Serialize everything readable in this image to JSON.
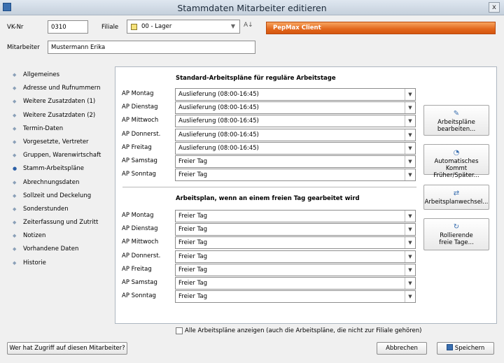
{
  "window": {
    "title": "Stammdaten Mitarbeiter editieren",
    "close": "x"
  },
  "header": {
    "vknr_label": "VK-Nr",
    "vknr_value": "0310",
    "filiale_label": "Filiale",
    "filiale_value": "00 - Lager",
    "mitarbeiter_label": "Mitarbeiter",
    "mitarbeiter_value": "Mustermann Erika",
    "banner_text": "PepMax Client",
    "banner_color": "#e2661b"
  },
  "sidebar": {
    "items": [
      {
        "label": "Allgemeines"
      },
      {
        "label": "Adresse und Rufnummern"
      },
      {
        "label": "Weitere Zusatzdaten (1)"
      },
      {
        "label": "Weitere Zusatzdaten (2)"
      },
      {
        "label": "Termin-Daten"
      },
      {
        "label": "Vorgesetzte, Vertreter"
      },
      {
        "label": "Gruppen, Warenwirtschaft"
      },
      {
        "label": "Stamm-Arbeitspläne",
        "active": true
      },
      {
        "label": "Abrechnungsdaten"
      },
      {
        "label": "Sollzeit und Deckelung"
      },
      {
        "label": "Sonderstunden"
      },
      {
        "label": "Zeiterfassung und Zutritt"
      },
      {
        "label": "Notizen"
      },
      {
        "label": "Vorhandene Daten"
      },
      {
        "label": "Historie"
      }
    ]
  },
  "standard": {
    "title": "Standard-Arbeitspläne für reguläre Arbeitstage",
    "rows": [
      {
        "day": "AP Montag",
        "value": "Auslieferung (08:00-16:45)"
      },
      {
        "day": "AP Dienstag",
        "value": "Auslieferung (08:00-16:45)"
      },
      {
        "day": "AP Mittwoch",
        "value": "Auslieferung (08:00-16:45)"
      },
      {
        "day": "AP Donnerst.",
        "value": "Auslieferung (08:00-16:45)"
      },
      {
        "day": "AP Freitag",
        "value": "Auslieferung (08:00-16:45)"
      },
      {
        "day": "AP Samstag",
        "value": "Freier Tag"
      },
      {
        "day": "AP Sonntag",
        "value": "Freier Tag"
      }
    ]
  },
  "free": {
    "title": "Arbeitsplan, wenn an einem freien Tag gearbeitet wird",
    "rows": [
      {
        "day": "AP Montag",
        "value": "Freier Tag"
      },
      {
        "day": "AP Dienstag",
        "value": "Freier Tag"
      },
      {
        "day": "AP Mittwoch",
        "value": "Freier Tag"
      },
      {
        "day": "AP Donnerst.",
        "value": "Freier Tag"
      },
      {
        "day": "AP Freitag",
        "value": "Freier Tag"
      },
      {
        "day": "AP Samstag",
        "value": "Freier Tag"
      },
      {
        "day": "AP Sonntag",
        "value": "Freier Tag"
      }
    ]
  },
  "side_buttons": [
    {
      "line1": "Arbeitspläne",
      "line2": "bearbeiten...",
      "icon": "schedule-edit-icon"
    },
    {
      "line1": "Automatisches Kommt",
      "line2": "Früher/Später...",
      "icon": "clock-icon"
    },
    {
      "line1": "Arbeitsplanwechsel...",
      "line2": "",
      "icon": "swap-icon"
    },
    {
      "line1": "Rollierende",
      "line2": "freie Tage...",
      "icon": "rotate-icon"
    }
  ],
  "show_all": {
    "label": "Alle Arbeitspläne anzeigen (auch die Arbeitspläne, die nicht zur Filiale gehören)",
    "checked": false
  },
  "footer": {
    "access_button": "Wer hat Zugriff auf diesen Mitarbeiter?",
    "cancel_button": "Abbrechen",
    "save_button": "Speichern"
  }
}
